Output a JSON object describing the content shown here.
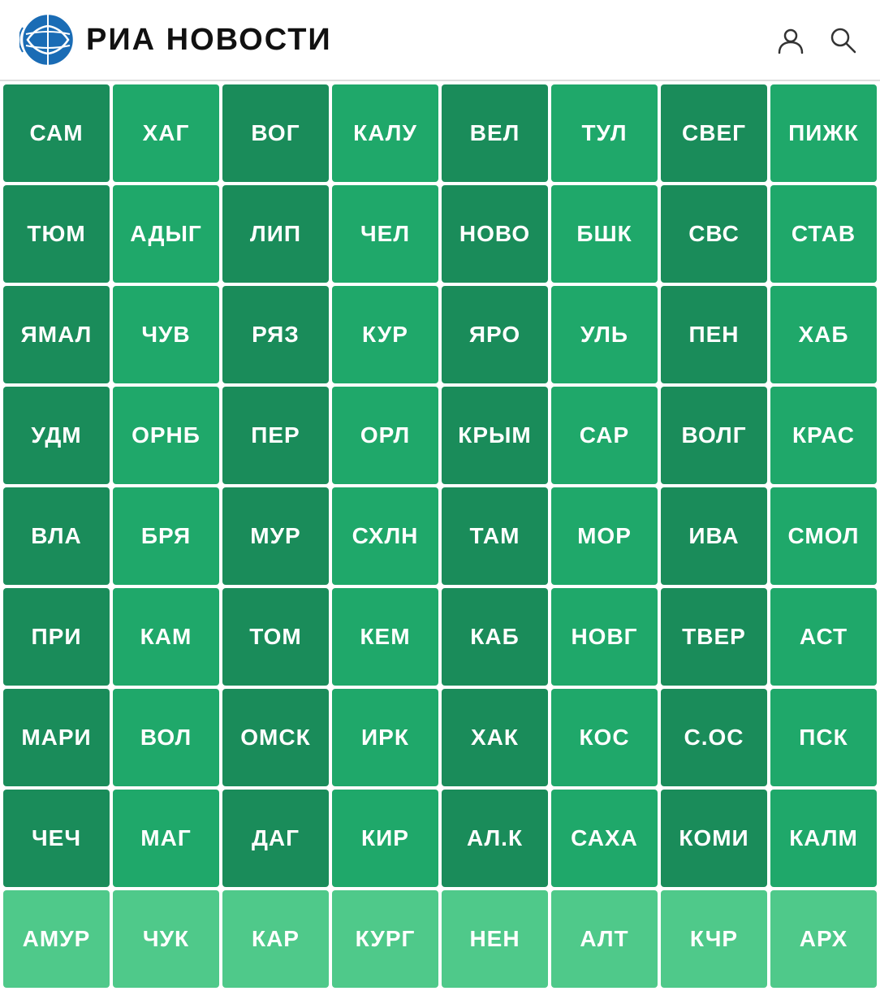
{
  "header": {
    "logo_text": "РИА НОВОСТИ",
    "user_icon": "user-icon",
    "search_icon": "search-icon"
  },
  "grid": {
    "rows": [
      [
        {
          "label": "САМ",
          "shade": "dark"
        },
        {
          "label": "ХАГ",
          "shade": "mid"
        },
        {
          "label": "ВОГ",
          "shade": "dark"
        },
        {
          "label": "КАЛУ",
          "shade": "mid"
        },
        {
          "label": "ВЕЛ",
          "shade": "dark"
        },
        {
          "label": "ТУЛ",
          "shade": "mid"
        },
        {
          "label": "СВЕГ",
          "shade": "dark"
        },
        {
          "label": "ПИЖК",
          "shade": "mid"
        }
      ],
      [
        {
          "label": "ТЮМ",
          "shade": "dark"
        },
        {
          "label": "АДЫГ",
          "shade": "mid"
        },
        {
          "label": "ЛИП",
          "shade": "dark"
        },
        {
          "label": "ЧЕЛ",
          "shade": "mid"
        },
        {
          "label": "НОВО",
          "shade": "dark"
        },
        {
          "label": "БШК",
          "shade": "mid"
        },
        {
          "label": "СВС",
          "shade": "dark"
        },
        {
          "label": "СТАВ",
          "shade": "mid"
        }
      ],
      [
        {
          "label": "ЯМАЛ",
          "shade": "dark"
        },
        {
          "label": "ЧУВ",
          "shade": "mid"
        },
        {
          "label": "РЯЗ",
          "shade": "dark"
        },
        {
          "label": "КУР",
          "shade": "mid"
        },
        {
          "label": "ЯРО",
          "shade": "dark"
        },
        {
          "label": "УЛЬ",
          "shade": "mid"
        },
        {
          "label": "ПЕН",
          "shade": "dark"
        },
        {
          "label": "ХАБ",
          "shade": "mid"
        }
      ],
      [
        {
          "label": "УДМ",
          "shade": "dark"
        },
        {
          "label": "ОРНБ",
          "shade": "mid"
        },
        {
          "label": "ПЕР",
          "shade": "dark"
        },
        {
          "label": "ОРЛ",
          "shade": "mid"
        },
        {
          "label": "КРЫМ",
          "shade": "dark"
        },
        {
          "label": "САР",
          "shade": "mid"
        },
        {
          "label": "ВОЛГ",
          "shade": "dark"
        },
        {
          "label": "КРАС",
          "shade": "mid"
        }
      ],
      [
        {
          "label": "ВЛА",
          "shade": "dark"
        },
        {
          "label": "БРЯ",
          "shade": "mid"
        },
        {
          "label": "МУР",
          "shade": "dark"
        },
        {
          "label": "СХЛН",
          "shade": "mid"
        },
        {
          "label": "ТАМ",
          "shade": "dark"
        },
        {
          "label": "МОР",
          "shade": "mid"
        },
        {
          "label": "ИВА",
          "shade": "dark"
        },
        {
          "label": "СМОЛ",
          "shade": "mid"
        }
      ],
      [
        {
          "label": "ПРИ",
          "shade": "dark"
        },
        {
          "label": "КАМ",
          "shade": "mid"
        },
        {
          "label": "ТОМ",
          "shade": "dark"
        },
        {
          "label": "КЕМ",
          "shade": "mid"
        },
        {
          "label": "КАБ",
          "shade": "dark"
        },
        {
          "label": "НОВГ",
          "shade": "mid"
        },
        {
          "label": "ТВЕР",
          "shade": "dark"
        },
        {
          "label": "АСТ",
          "shade": "mid"
        }
      ],
      [
        {
          "label": "МАРИ",
          "shade": "dark"
        },
        {
          "label": "ВОЛ",
          "shade": "mid"
        },
        {
          "label": "ОМСК",
          "shade": "dark"
        },
        {
          "label": "ИРК",
          "shade": "mid"
        },
        {
          "label": "ХАК",
          "shade": "dark"
        },
        {
          "label": "КОС",
          "shade": "mid"
        },
        {
          "label": "С.ОС",
          "shade": "dark"
        },
        {
          "label": "ПСК",
          "shade": "mid"
        }
      ],
      [
        {
          "label": "ЧЕЧ",
          "shade": "dark"
        },
        {
          "label": "МАГ",
          "shade": "mid"
        },
        {
          "label": "ДАГ",
          "shade": "dark"
        },
        {
          "label": "КИР",
          "shade": "mid"
        },
        {
          "label": "АЛ.К",
          "shade": "dark"
        },
        {
          "label": "САХА",
          "shade": "mid"
        },
        {
          "label": "КОМИ",
          "shade": "dark"
        },
        {
          "label": "КАЛМ",
          "shade": "mid"
        }
      ],
      [
        {
          "label": "АМУР",
          "shade": "light"
        },
        {
          "label": "ЧУК",
          "shade": "light"
        },
        {
          "label": "КАР",
          "shade": "light"
        },
        {
          "label": "КУРГ",
          "shade": "light"
        },
        {
          "label": "НЕН",
          "shade": "light"
        },
        {
          "label": "АЛТ",
          "shade": "light"
        },
        {
          "label": "КЧР",
          "shade": "light"
        },
        {
          "label": "АРХ",
          "shade": "light"
        }
      ]
    ]
  }
}
